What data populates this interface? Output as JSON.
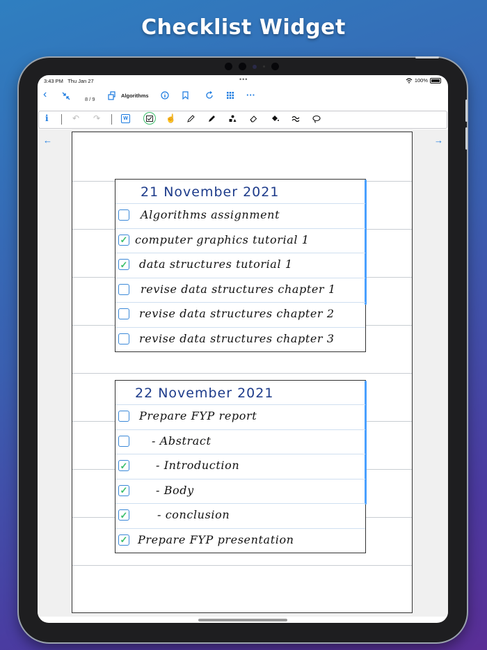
{
  "promo_title": "Checklist Widget",
  "status": {
    "time": "3:43 PM",
    "date": "Thu Jan 27",
    "battery": "100%",
    "dots": "•••"
  },
  "nav": {
    "page_count": "8 / 9",
    "doc_title": "Algorithms",
    "icons": [
      "back-chevron-icon",
      "collapse-icon",
      "share-doc-icon",
      "info-circle-icon",
      "bookmark-icon",
      "refresh-icon",
      "grid-icon",
      "more-icon"
    ]
  },
  "tools": {
    "info_label": "i",
    "word_label": "W",
    "icons": [
      "info-icon",
      "undo-icon",
      "redo-icon",
      "word-icon",
      "checklist-widget-icon",
      "hand-touch-icon",
      "pen-icon",
      "marker-icon",
      "shapes-icon",
      "eraser-icon",
      "fill-icon",
      "stroke-icon",
      "lasso-icon"
    ]
  },
  "page_nav": {
    "prev": "←",
    "next": "→"
  },
  "checklists": [
    {
      "title": "21 November 2021",
      "items": [
        {
          "text": "Algorithms assignment",
          "checked": false
        },
        {
          "text": "computer graphics tutorial 1",
          "checked": true
        },
        {
          "text": "data structures tutorial 1",
          "checked": true
        },
        {
          "text": "revise data structures chapter 1",
          "checked": false
        },
        {
          "text": "revise data structures chapter 2",
          "checked": false
        },
        {
          "text": "revise data structures chapter 3",
          "checked": false
        }
      ]
    },
    {
      "title": "22 November 2021",
      "items": [
        {
          "text": "Prepare FYP report",
          "checked": false
        },
        {
          "text": "- Abstract",
          "checked": false
        },
        {
          "text": "- Introduction",
          "checked": true
        },
        {
          "text": "- Body",
          "checked": true
        },
        {
          "text": "- conclusion",
          "checked": true
        },
        {
          "text": "Prepare FYP presentation",
          "checked": true
        }
      ]
    }
  ],
  "colors": {
    "accent": "#1a7ae0",
    "check": "#3cbf6c",
    "ink_title": "#1d3b8a"
  }
}
